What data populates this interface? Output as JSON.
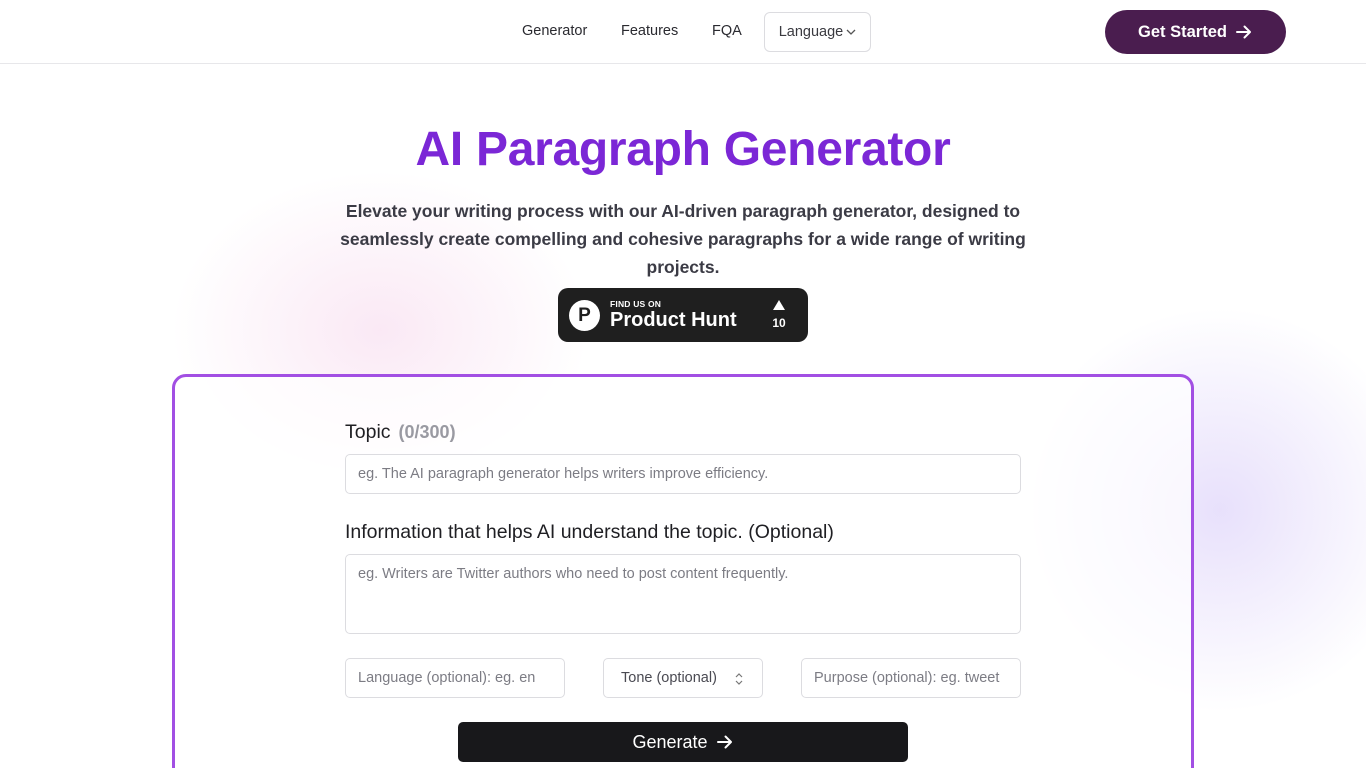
{
  "nav": {
    "links": [
      "Generator",
      "Features",
      "FQA"
    ],
    "language_label": "Language",
    "cta_label": "Get Started"
  },
  "hero": {
    "title": "AI Paragraph Generator",
    "subtitle": "Elevate your writing process with our AI-driven paragraph generator, designed to seamlessly create compelling and cohesive paragraphs for a wide range of writing projects."
  },
  "product_hunt": {
    "find_text": "FIND US ON",
    "name": "Product Hunt",
    "votes": "10"
  },
  "form": {
    "topic_label": "Topic",
    "topic_count": "(0/300)",
    "topic_placeholder": "eg. The AI paragraph generator helps writers improve efficiency.",
    "info_label": "Information that helps AI understand the topic. (Optional)",
    "info_placeholder": "eg. Writers are Twitter authors who need to post content frequently.",
    "language_placeholder": "Language (optional): eg. en",
    "tone_label": "Tone (optional)",
    "purpose_placeholder": "Purpose (optional): eg. tweet",
    "generate_label": "Generate"
  },
  "colors": {
    "title": "#7b27d6",
    "cta_bg": "#4a1d4f",
    "card_border": "#a24fe3",
    "generate_bg": "#18181b"
  }
}
